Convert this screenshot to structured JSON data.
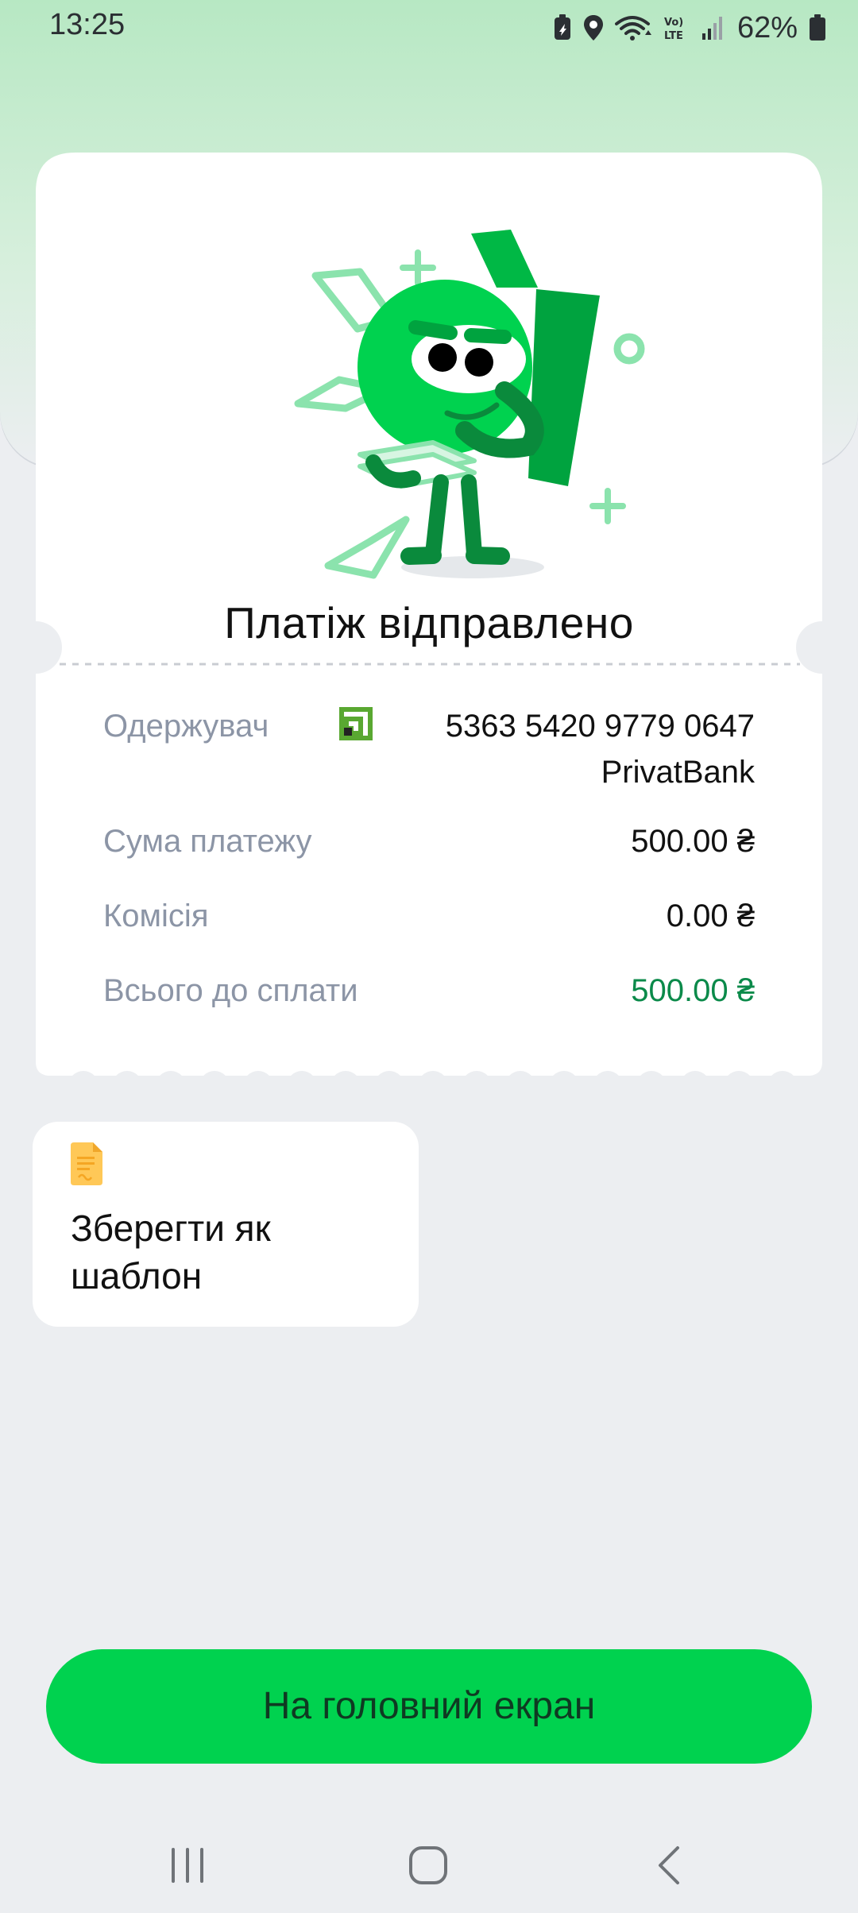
{
  "status_bar": {
    "time": "13:25",
    "battery": "62%"
  },
  "receipt": {
    "title": "Платіж відправлено",
    "rows": {
      "recipient": {
        "label": "Одержувач",
        "card_number": "5363 5420 9779 0647",
        "bank": "PrivatBank"
      },
      "amount": {
        "label": "Сума платежу",
        "value": "500.00 ₴"
      },
      "commission": {
        "label": "Комісія",
        "value": "0.00 ₴"
      },
      "total": {
        "label": "Всього до сплати",
        "value": "500.00 ₴"
      }
    }
  },
  "template_card": {
    "label": "Зберегти як шаблон",
    "icon": "document-icon"
  },
  "home_button": {
    "label": "На головний екран"
  },
  "nav_bar": {
    "recents_icon": "recents-icon",
    "home_icon": "home-icon",
    "back_icon": "back-icon"
  },
  "colors": {
    "accent": "#00d24f",
    "total_amount": "#0b8a4a",
    "label_gray": "#8c95a6",
    "background": "#eceef1"
  }
}
